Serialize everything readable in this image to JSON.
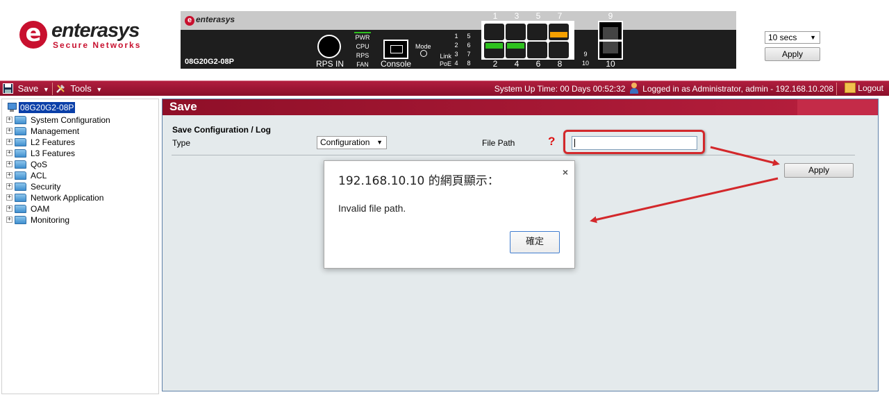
{
  "logo": {
    "mark": "e",
    "name": "enterasys",
    "tagline": "Secure Networks"
  },
  "device": {
    "brand": "enterasys",
    "model": "08G20G2-08P",
    "rps_label": "RPS IN",
    "leds": [
      "PWR",
      "CPU",
      "RPS",
      "FAN"
    ],
    "console_label": "Console",
    "mode_label": "Mode",
    "link_label": "Link",
    "poe_label": "PoE",
    "led_numbers_a": [
      "1",
      "2",
      "3",
      "4"
    ],
    "led_numbers_b": [
      "5",
      "6",
      "7",
      "8"
    ],
    "sfp_led_number_top": "9",
    "sfp_led_number_bottom": "10",
    "ports_top": [
      "1",
      "3",
      "5",
      "7"
    ],
    "ports_bottom": [
      "2",
      "4",
      "6",
      "8"
    ],
    "sfp_top": "9",
    "sfp_bottom": "10",
    "colors": {
      "link_green": "#2ec11e",
      "poe_orange": "#f5a000"
    }
  },
  "refresh": {
    "interval": "10 secs",
    "apply_label": "Apply"
  },
  "toolbar": {
    "save_label": "Save",
    "tools_label": "Tools",
    "uptime": "System Up Time: 00 Days 00:52:32",
    "login_info": "Logged in as Administrator, admin - 192.168.10.208",
    "logout_label": "Logout"
  },
  "sidebar": {
    "root": "08G20G2-08P",
    "items": [
      {
        "label": "System Configuration"
      },
      {
        "label": "Management"
      },
      {
        "label": "L2 Features"
      },
      {
        "label": "L3 Features"
      },
      {
        "label": "QoS"
      },
      {
        "label": "ACL"
      },
      {
        "label": "Security"
      },
      {
        "label": "Network Application"
      },
      {
        "label": "OAM"
      },
      {
        "label": "Monitoring"
      }
    ]
  },
  "main": {
    "title": "Save",
    "section_title": "Save Configuration / Log",
    "type_label": "Type",
    "type_value": "Configuration",
    "file_path_label": "File Path",
    "help_mark": "?",
    "file_path_value": "",
    "apply_label": "Apply"
  },
  "dialog": {
    "title": "192.168.10.10 的網頁顯示：",
    "message": "Invalid file path.",
    "ok_label": "確定",
    "close_glyph": "×"
  },
  "colors": {
    "brand_red": "#c8102e",
    "toolbar": "#a3183a",
    "annotation_red": "#d3282b",
    "selection_blue": "#0a3fa8"
  }
}
